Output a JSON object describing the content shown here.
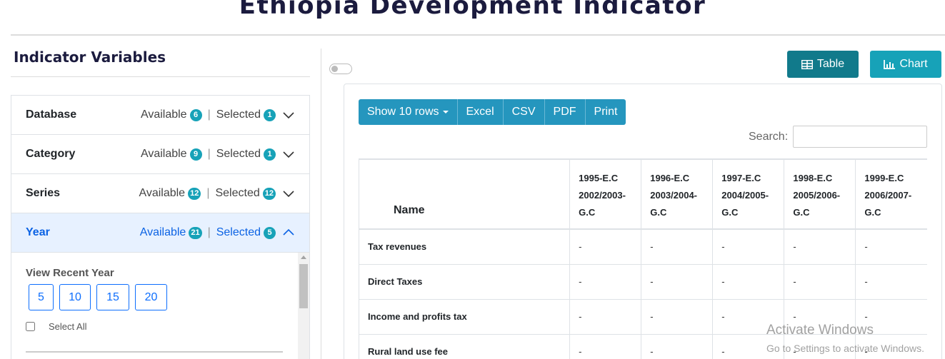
{
  "page_title": "Ethiopia Development Indicator",
  "left": {
    "heading": "Indicator Variables",
    "accordion": [
      {
        "label": "Database",
        "available_label": "Available",
        "available_count": "6",
        "selected_label": "Selected",
        "selected_count": "1",
        "open": false
      },
      {
        "label": "Category",
        "available_label": "Available",
        "available_count": "9",
        "selected_label": "Selected",
        "selected_count": "1",
        "open": false
      },
      {
        "label": "Series",
        "available_label": "Available",
        "available_count": "12",
        "selected_label": "Selected",
        "selected_count": "12",
        "open": false
      },
      {
        "label": "Year",
        "available_label": "Available",
        "available_count": "21",
        "selected_label": "Selected",
        "selected_count": "5",
        "open": true
      }
    ],
    "year_panel": {
      "recent_label": "View Recent Year",
      "buttons": [
        "5",
        "10",
        "15",
        "20"
      ],
      "select_all": "Select All"
    }
  },
  "view_buttons": {
    "table": "Table",
    "chart": "Chart"
  },
  "toolbar": {
    "show_rows": "Show 10 rows",
    "excel": "Excel",
    "csv": "CSV",
    "pdf": "PDF",
    "print": "Print"
  },
  "search": {
    "label": "Search:",
    "value": ""
  },
  "table": {
    "name_header": "Name",
    "year_headers": [
      [
        "1995-E.C",
        "2002/2003-",
        "G.C"
      ],
      [
        "1996-E.C",
        "2003/2004-",
        "G.C"
      ],
      [
        "1997-E.C",
        "2004/2005-",
        "G.C"
      ],
      [
        "1998-E.C",
        "2005/2006-",
        "G.C"
      ],
      [
        "1999-E.C",
        "2006/2007-",
        "G.C"
      ]
    ],
    "rows": [
      {
        "name": "Tax revenues",
        "values": [
          "-",
          "-",
          "-",
          "-",
          "-"
        ]
      },
      {
        "name": "Direct Taxes",
        "values": [
          "-",
          "-",
          "-",
          "-",
          "-"
        ]
      },
      {
        "name": "Income and profits tax",
        "values": [
          "-",
          "-",
          "-",
          "-",
          "-"
        ]
      },
      {
        "name": "Rural land use fee",
        "values": [
          "-",
          "-",
          "-",
          "-",
          "-"
        ]
      }
    ]
  },
  "watermark": {
    "title": "Activate Windows",
    "subtitle": "Go to Settings to activate Windows."
  },
  "colors": {
    "title": "#1b1b3e",
    "accent": "#17a2b8",
    "table_btn": "#117a8b",
    "toolbar": "#2596be",
    "open_row": "#e7f1ff",
    "open_text": "#0c63e4"
  }
}
